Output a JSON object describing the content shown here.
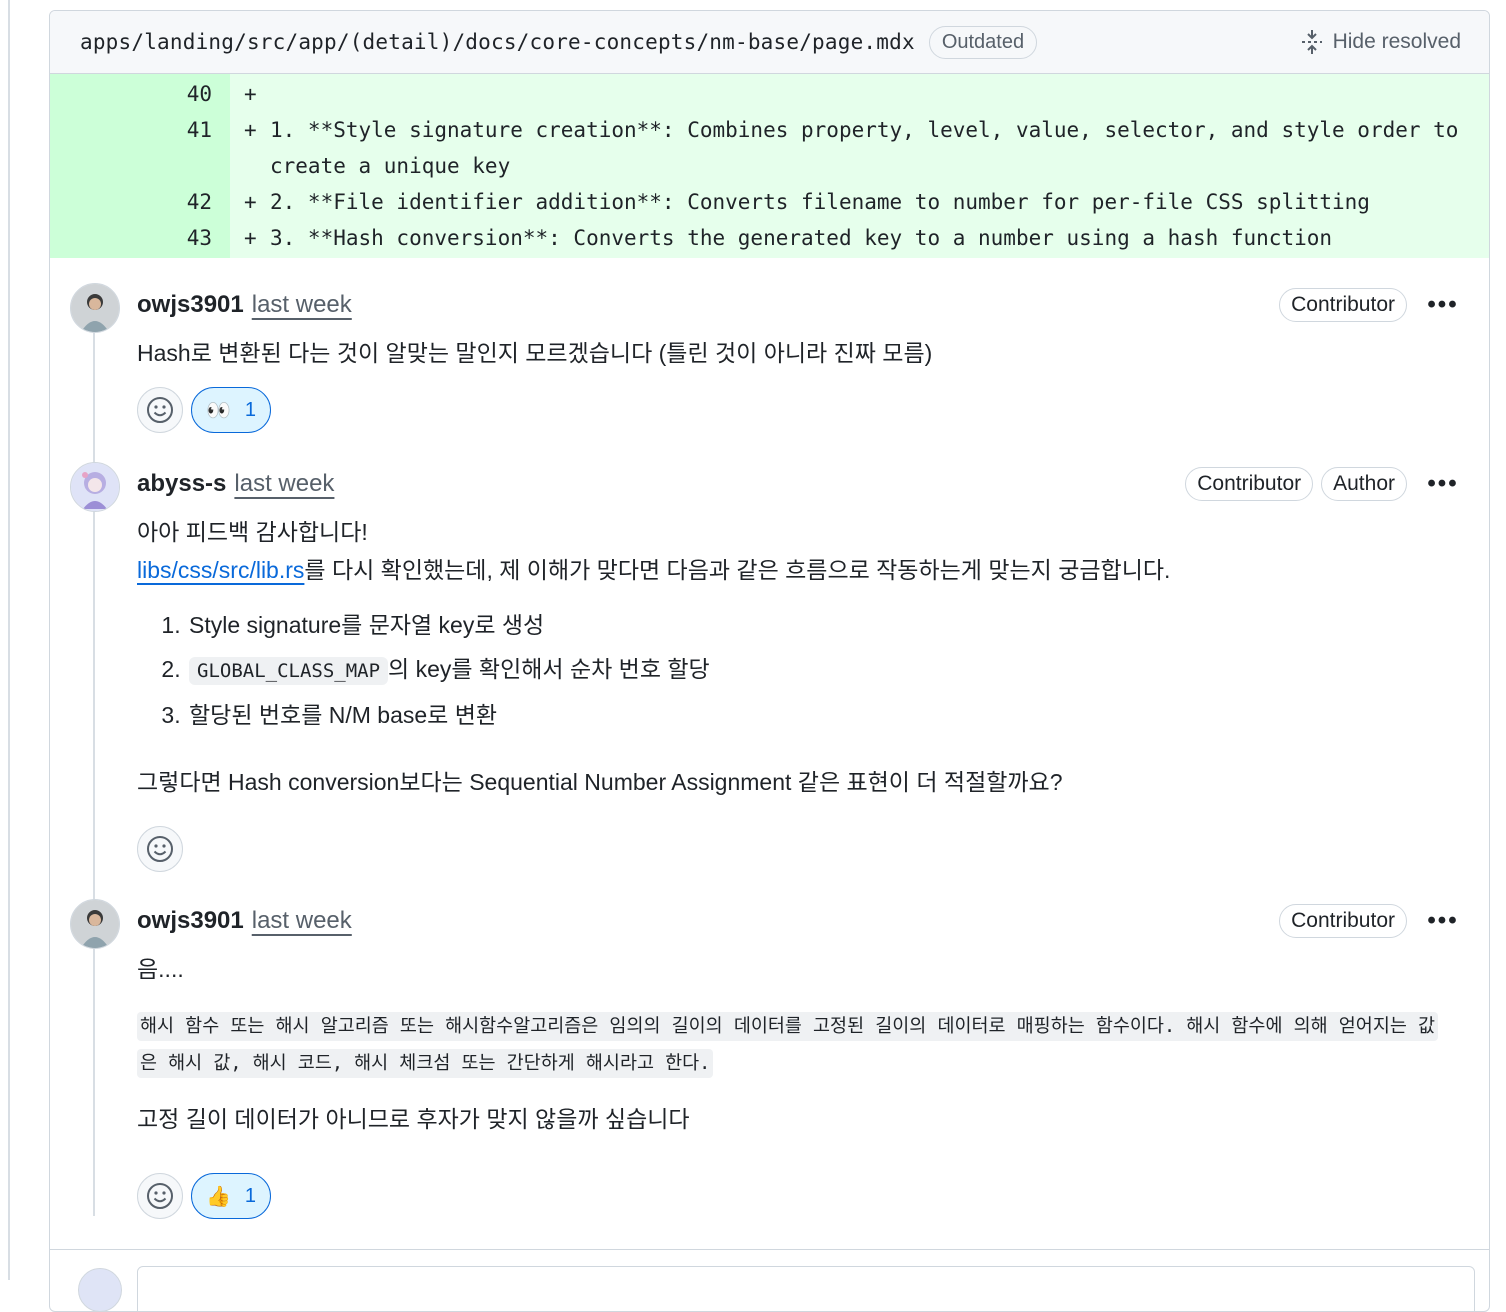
{
  "file": {
    "path": "apps/landing/src/app/(detail)/docs/core-concepts/nm-base/page.mdx",
    "status_badge": "Outdated",
    "hide_resolved_label": "Hide resolved"
  },
  "diff": {
    "rows": [
      {
        "line": "40",
        "sign": "+",
        "text": ""
      },
      {
        "line": "41",
        "sign": "+",
        "text": "1. **Style signature creation**: Combines property, level, value, selector, and style order to create a unique key"
      },
      {
        "line": "42",
        "sign": "+",
        "text": "2. **File identifier addition**: Converts filename to number for per-file CSS splitting"
      },
      {
        "line": "43",
        "sign": "+",
        "text": "3. **Hash conversion**: Converts the generated key to a number using a hash function"
      }
    ]
  },
  "comments": [
    {
      "author": "owjs3901",
      "time": "last week",
      "badges": [
        "Contributor"
      ],
      "more": "•••",
      "text": "Hash로 변환된 다는 것이 알맞는 말인지 모르겠습니다 (틀린 것이 아니라 진짜 모름)",
      "reaction": {
        "emoji": "👀",
        "count": "1"
      }
    },
    {
      "author": "abyss-s",
      "time": "last week",
      "badges": [
        "Contributor",
        "Author"
      ],
      "more": "•••",
      "line1": "아아 피드백 감사합니다!",
      "link": "libs/css/src/lib.rs",
      "line2_rest": "를 다시 확인했는데, 제 이해가 맞다면 다음과 같은 흐름으로 작동하는게 맞는지 궁금합니다.",
      "list": {
        "item1": "Style signature를 문자열 key로 생성",
        "item2_code": "GLOBAL_CLASS_MAP",
        "item2_rest": "의 key를 확인해서 순차 번호 할당",
        "item3": "할당된 번호를 N/M base로 변환"
      },
      "closing": "그렇다면 Hash conversion보다는 Sequential Number Assignment 같은 표현이 더 적절할까요?"
    },
    {
      "author": "owjs3901",
      "time": "last week",
      "badges": [
        "Contributor"
      ],
      "more": "•••",
      "line1": "음....",
      "quote": "해시 함수 또는 해시 알고리즘 또는 해시함수알고리즘은 임의의 길이의 데이터를 고정된 길이의 데이터로 매핑하는 함수이다. 해시 함수에 의해 얻어지는 값은 해시 값, 해시 코드, 해시 체크섬 또는 간단하게 해시라고 한다.",
      "closing": "고정 길이 데이터가 아니므로 후자가 맞지 않을까 싶습니다",
      "reaction": {
        "emoji": "👍",
        "count": "1"
      }
    }
  ],
  "icons": {
    "hide_resolved": "fold-icon",
    "add_reaction": "smiley-icon"
  },
  "colors": {
    "link": "#0969da",
    "added_line_bg": "#e6ffec",
    "added_num_bg": "#ccffd8"
  }
}
